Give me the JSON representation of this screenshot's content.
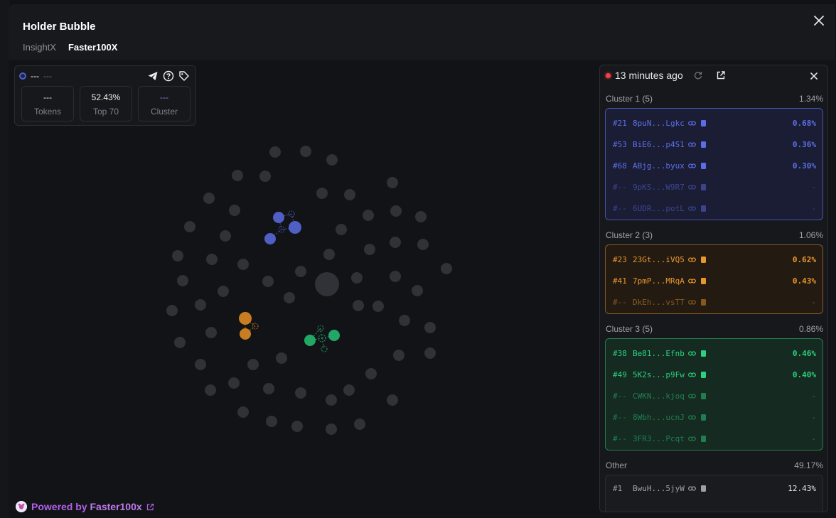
{
  "modal": {
    "title": "Holder Bubble",
    "tabs": [
      {
        "label": "InsightX",
        "active": false
      },
      {
        "label": "Faster100X",
        "active": true
      }
    ]
  },
  "stats": {
    "name": "---",
    "sub": "---",
    "tokens": {
      "value": "---",
      "label": "Tokens"
    },
    "top": {
      "value": "52.43%",
      "label": "Top 70"
    },
    "cluster": {
      "value": "---",
      "label": "Cluster"
    }
  },
  "panel": {
    "updated": "13 minutes ago",
    "clusters": [
      {
        "name": "Cluster 1 (5)",
        "pct": "1.34%",
        "color": "#5b6ee8",
        "bg": "#1b1d34",
        "border": "#4653b0",
        "rows": [
          {
            "rank": "#21",
            "addr": "8puN...Lgkc",
            "pct": "0.68%",
            "dim": false
          },
          {
            "rank": "#53",
            "addr": "BiE6...p4S1",
            "pct": "0.36%",
            "dim": false
          },
          {
            "rank": "#68",
            "addr": "ABjg...byux",
            "pct": "0.30%",
            "dim": false
          },
          {
            "rank": "#--",
            "addr": "9pKS...W9R7",
            "pct": "-",
            "dim": true
          },
          {
            "rank": "#--",
            "addr": "6UDR...potL",
            "pct": "-",
            "dim": true
          }
        ]
      },
      {
        "name": "Cluster 2 (3)",
        "pct": "1.06%",
        "color": "#e8962e",
        "bg": "#231b12",
        "border": "#8a5a22",
        "rows": [
          {
            "rank": "#23",
            "addr": "23Gt...iVQ5",
            "pct": "0.62%",
            "dim": false
          },
          {
            "rank": "#41",
            "addr": "7pmP...MRqA",
            "pct": "0.43%",
            "dim": false
          },
          {
            "rank": "#--",
            "addr": "DkEh...vsTT",
            "pct": "-",
            "dim": true
          }
        ]
      },
      {
        "name": "Cluster 3 (5)",
        "pct": "0.86%",
        "color": "#2bd17e",
        "bg": "#152a21",
        "border": "#23804f",
        "rows": [
          {
            "rank": "#38",
            "addr": "Be81...Efnb",
            "pct": "0.46%",
            "dim": false
          },
          {
            "rank": "#49",
            "addr": "5K2s...p9Fw",
            "pct": "0.40%",
            "dim": false
          },
          {
            "rank": "#--",
            "addr": "CWKN...kjoq",
            "pct": "-",
            "dim": true
          },
          {
            "rank": "#--",
            "addr": "8Wbh...ucnJ",
            "pct": "-",
            "dim": true
          },
          {
            "rank": "#--",
            "addr": "3FR3...Pcqt",
            "pct": "-",
            "dim": true
          }
        ]
      }
    ],
    "other": {
      "name": "Other",
      "pct": "49.17%",
      "rows": [
        {
          "rank": "#1",
          "addr": "BwuH...5jyW",
          "pct": "12.43%"
        }
      ]
    }
  },
  "footer": {
    "prefix": "Powered by",
    "brand": "Faster100x"
  },
  "colors": {
    "bubble": "#303238",
    "cluster1": "#4f5fc4",
    "cluster2": "#c97d22",
    "cluster3": "#22a866"
  }
}
